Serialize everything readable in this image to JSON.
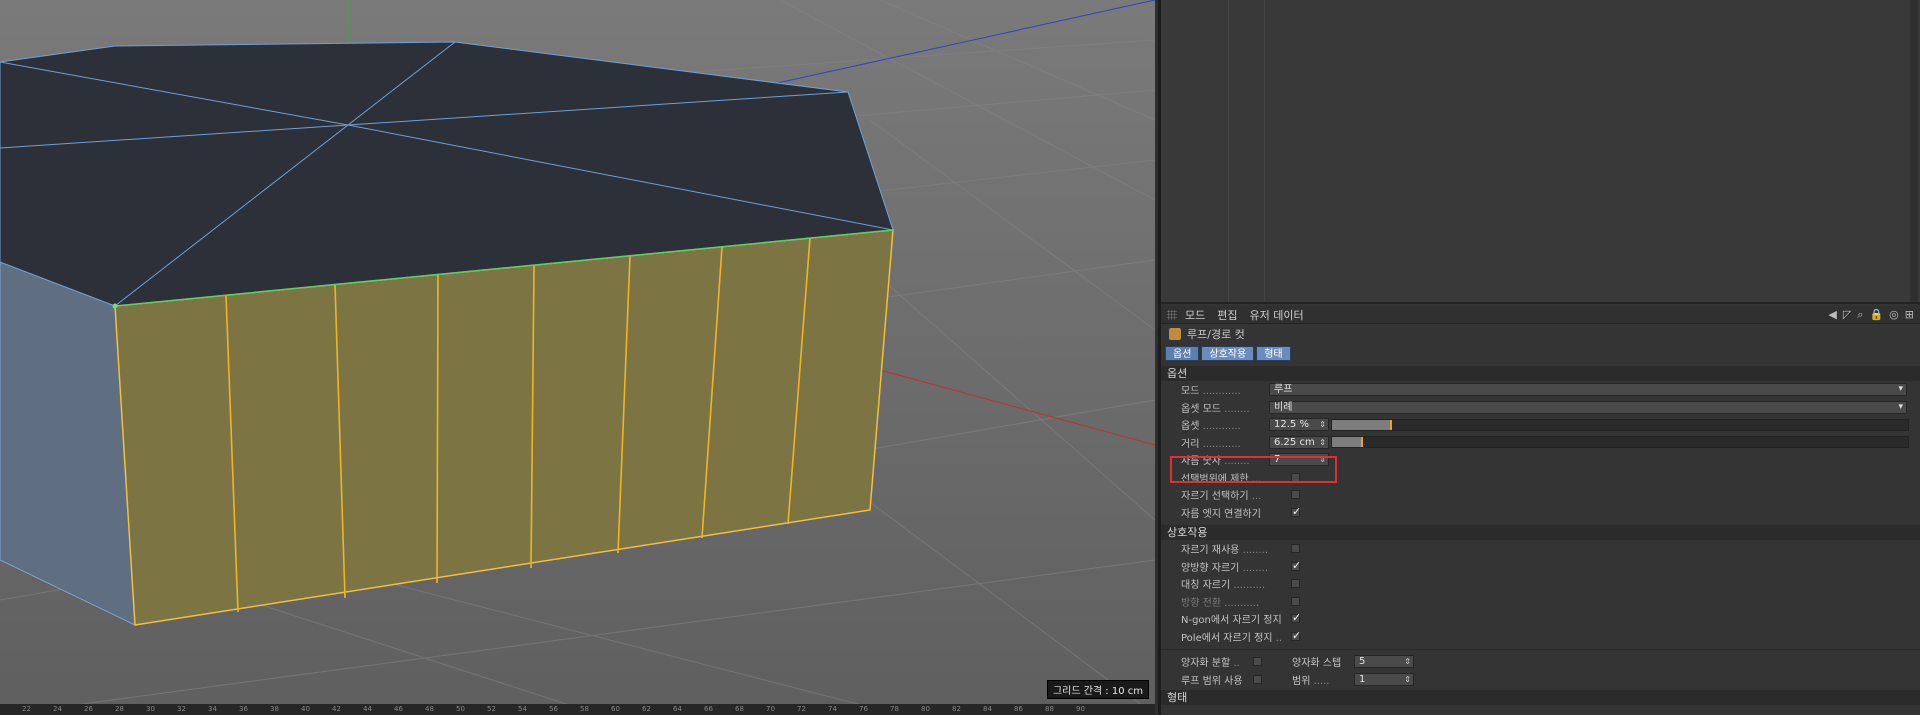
{
  "viewport": {
    "grid_spacing": "그리드 간격 : 10 cm",
    "ruler": [
      "22",
      "24",
      "26",
      "28",
      "30",
      "32",
      "34",
      "36",
      "38",
      "40",
      "42",
      "44",
      "46",
      "48",
      "50",
      "52",
      "54",
      "56",
      "58",
      "60",
      "62",
      "64",
      "66",
      "68",
      "70",
      "72",
      "74",
      "76",
      "78",
      "80",
      "82",
      "84",
      "86",
      "88",
      "90"
    ]
  },
  "attr": {
    "menu": [
      "모드",
      "편집",
      "유저 데이터"
    ],
    "tools": [
      "◀",
      "◸",
      "⌕",
      "🔒",
      "◎",
      "⊞"
    ],
    "object_title": "루프/경로 컷",
    "tabs": [
      "옵션",
      "상호작용",
      "형태"
    ],
    "sections": {
      "options": "옵션",
      "interaction": "상호작용",
      "shape": "형태"
    },
    "options": {
      "mode": {
        "label": "모드",
        "value": "루프"
      },
      "offset_mode": {
        "label": "옵셋 모드",
        "value": "비례"
      },
      "offset": {
        "label": "옵셋",
        "value": "12.5 %",
        "fraction": 0.1
      },
      "distance": {
        "label": "거리",
        "value": "6.25 cm",
        "fraction": 0.05
      },
      "cut_count": {
        "label": "자름 숫자",
        "value": "7"
      },
      "restrict_selection": {
        "label": "선택범위에 제한",
        "checked": false
      },
      "select_cuts": {
        "label": "자르기 선택하기",
        "checked": false
      },
      "connect_edges": {
        "label": "자름 엣지 연결하기",
        "checked": true
      }
    },
    "interaction": {
      "reuse_cuts": {
        "label": "자르기 재사용",
        "checked": false
      },
      "bidirectional": {
        "label": "양방향 자르기",
        "checked": true
      },
      "symmetric": {
        "label": "대칭 자르기",
        "checked": false
      },
      "flip_direction": {
        "label": "방향 전환",
        "checked": false
      },
      "stop_ngon": {
        "label": "N-gon에서 자르기 정지",
        "checked": true
      },
      "stop_pole": {
        "label": "Pole에서 자르기 정지",
        "checked": true
      }
    },
    "quantize": {
      "split": {
        "label": "양자화 분할",
        "checked": false
      },
      "step_label": "양자화 스텝",
      "step_value": "5",
      "loop_range": {
        "label": "루프 범위 사용",
        "checked": false
      },
      "range_label": "범위",
      "range_value": "1"
    }
  }
}
